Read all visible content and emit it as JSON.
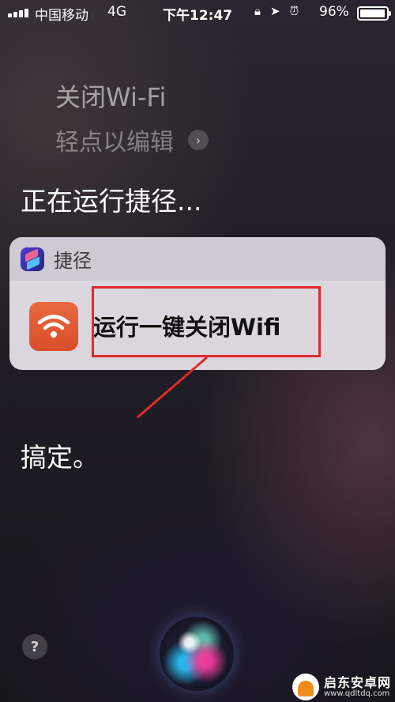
{
  "status_bar": {
    "carrier": "中国移动",
    "network": "4G",
    "time": "下午12:47",
    "battery_percent": "96%",
    "battery_level": 0.96
  },
  "siri": {
    "query": "关闭Wi-Fi",
    "edit_hint": "轻点以编辑",
    "running_text": "正在运行捷径...",
    "done_text": "搞定。"
  },
  "card": {
    "app_name": "捷径",
    "shortcut_name": "运行一键关闭Wifi",
    "tile_color": "#e05c34"
  },
  "annotation": {
    "color": "#e02a2a"
  },
  "help_label": "?",
  "watermark": {
    "title": "启东安卓网",
    "url": "www.qdltdq.com"
  }
}
